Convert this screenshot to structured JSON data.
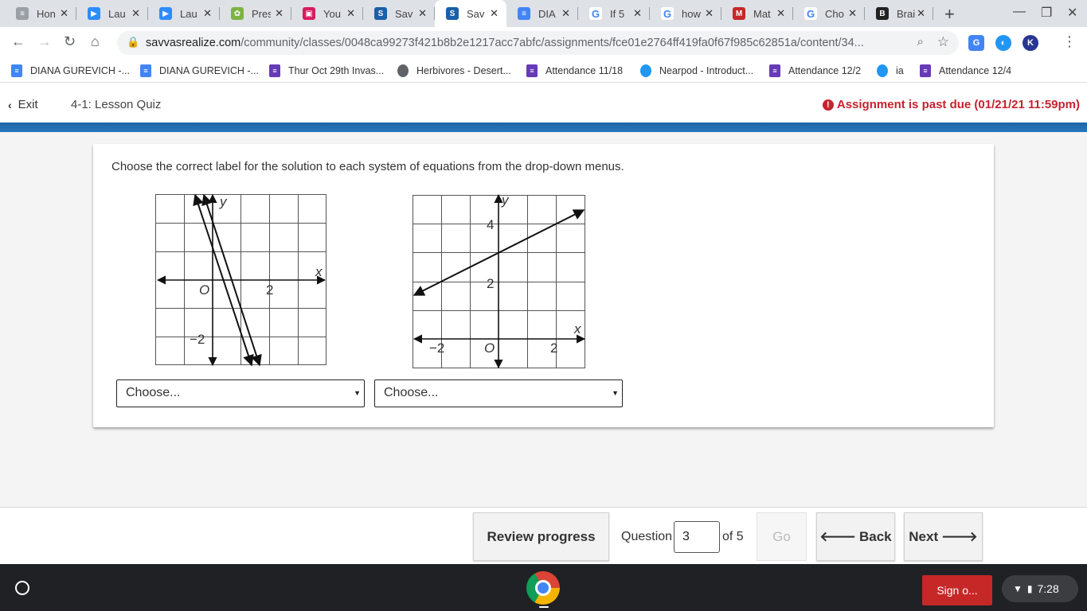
{
  "browser": {
    "tabs": [
      {
        "title": "Hon",
        "icon": "docs-icon",
        "color": "#9aa0a6",
        "glyph": "≡",
        "active": false
      },
      {
        "title": "Lau",
        "icon": "zoom-icon",
        "color": "#2d8cff",
        "glyph": "▶",
        "active": false
      },
      {
        "title": "Lau",
        "icon": "zoom-icon",
        "color": "#2d8cff",
        "glyph": "▶",
        "active": false
      },
      {
        "title": "Pres",
        "icon": "pear-deck-icon",
        "color": "#7cb342",
        "glyph": "✿",
        "active": false
      },
      {
        "title": "You",
        "icon": "contacts-icon",
        "color": "#d81b60",
        "glyph": "▣",
        "active": false
      },
      {
        "title": "Sav",
        "icon": "savvas-icon",
        "color": "#1a5fa8",
        "glyph": "S",
        "active": false
      },
      {
        "title": "Sav",
        "icon": "savvas-icon",
        "color": "#1a5fa8",
        "glyph": "S",
        "active": true
      },
      {
        "title": "DIA",
        "icon": "docs-icon",
        "color": "#4285f4",
        "glyph": "≡",
        "active": false
      },
      {
        "title": "If 5",
        "icon": "google-icon",
        "color": "#ffffff",
        "glyph": "G",
        "active": false
      },
      {
        "title": "how",
        "icon": "google-icon",
        "color": "#ffffff",
        "glyph": "G",
        "active": false
      },
      {
        "title": "Mat",
        "icon": "mathway-icon",
        "color": "#c62828",
        "glyph": "M",
        "active": false
      },
      {
        "title": "Cho",
        "icon": "google-icon",
        "color": "#ffffff",
        "glyph": "G",
        "active": false
      },
      {
        "title": "Brai",
        "icon": "brainly-icon",
        "color": "#222222",
        "glyph": "B",
        "active": false
      }
    ],
    "url_host": "savvasrealize.com",
    "url_path": "/community/classes/0048ca99273f421b8b2e1217acc7abfc/assignments/fce01e2764ff419fa0f67f985c62851a/content/34...",
    "bookmarks": [
      {
        "label": "DIANA GUREVICH -...",
        "icon": "docs-icon",
        "color": "#4285f4"
      },
      {
        "label": "DIANA GUREVICH -...",
        "icon": "docs-icon",
        "color": "#4285f4"
      },
      {
        "label": "Thur Oct 29th Invas...",
        "icon": "forms-icon",
        "color": "#673ab7"
      },
      {
        "label": "Herbivores - Desert...",
        "icon": "globe-icon",
        "color": "#5f6368"
      },
      {
        "label": "Attendance 11/18",
        "icon": "forms-icon",
        "color": "#673ab7"
      },
      {
        "label": "Nearpod - Introduct...",
        "icon": "nearpod-icon",
        "color": "#2196f3"
      },
      {
        "label": "Attendance 12/2",
        "icon": "forms-icon",
        "color": "#673ab7"
      },
      {
        "label": "ia",
        "icon": "nearpod-icon",
        "color": "#2196f3"
      },
      {
        "label": "Attendance 12/4",
        "icon": "forms-icon",
        "color": "#673ab7"
      }
    ]
  },
  "header": {
    "exit_label": "Exit",
    "title": "4-1: Lesson Quiz",
    "due_notice": "Assignment is past due (01/21/21 11:59pm)",
    "due_color": "#c5232f"
  },
  "question": {
    "prompt": "Choose the correct label for the solution to each system of equations from the drop-down menus.",
    "graph1": {
      "axis_x_label": "x",
      "axis_y_label": "y",
      "origin_label": "O",
      "tick_x": "2",
      "tick_y": "−2"
    },
    "graph2": {
      "axis_x_label": "x",
      "axis_y_label": "y",
      "origin_label": "O",
      "tick_x_neg": "−2",
      "tick_x_pos": "2",
      "tick_y_2": "2",
      "tick_y_4": "4"
    },
    "dropdown1_value": "Choose...",
    "dropdown2_value": "Choose..."
  },
  "footer": {
    "review_label": "Review progress",
    "question_label": "Question",
    "question_value": "3",
    "question_total": "of 5",
    "go_label": "Go",
    "back_label": "Back",
    "next_label": "Next"
  },
  "shelf": {
    "signout_label": "Sign o...",
    "time": "7:28",
    "signout_color": "#c62828"
  }
}
